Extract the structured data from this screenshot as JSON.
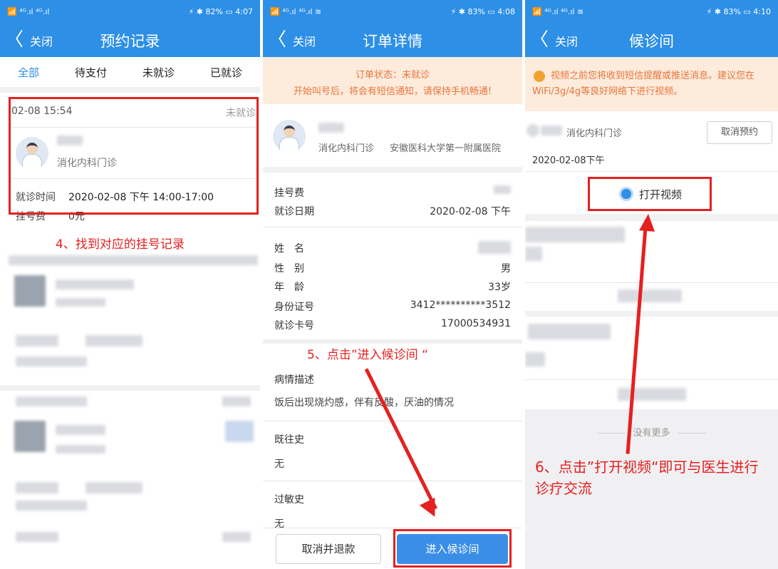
{
  "colors": {
    "brand": "#2d8fe6",
    "annotation": "#e52020",
    "notice_bg": "#fdebdc",
    "notice_text": "#e8763a",
    "primary_button": "#3a8ee6"
  },
  "panel1": {
    "status": {
      "left": "📶 ⁴ᴳ.ıl ⁴ᴳ.ıl",
      "right": "⚡ ✱ 82% ▭ 4:07"
    },
    "nav": {
      "back": "〈",
      "close": "关闭",
      "title": "预约记录"
    },
    "tabs": [
      "全部",
      "待支付",
      "未就诊",
      "已就诊"
    ],
    "record": {
      "datetime": "02-08 15:54",
      "status": "未就诊",
      "dept": "消化内科门诊",
      "visit_time_label": "就诊时间",
      "visit_time_value": "2020-02-08 下午 14:00-17:00",
      "fee_label": "挂号费",
      "fee_value": "0元"
    },
    "annotation": "4、找到对应的挂号记录"
  },
  "panel2": {
    "status": {
      "left": "📶 ⁴ᴳ.ıl ⁴ᴳ.ıl ≋",
      "right": "⚡ ✱ 83% ▭ 4:08"
    },
    "nav": {
      "back": "〈",
      "close": "关闭",
      "title": "订单详情"
    },
    "notice": {
      "line1": "订单状态：未就诊",
      "line2": "开始叫号后，将会有短信通知，请保持手机畅通!"
    },
    "doctor": {
      "dept": "消化内科门诊",
      "hospital": "安徽医科大学第一附属医院"
    },
    "fee_label": "挂号费",
    "visit_date_label": "就诊日期",
    "visit_date_value": "2020-02-08 下午",
    "fields": [
      {
        "label": "姓　名",
        "value": ""
      },
      {
        "label": "性　别",
        "value": "男"
      },
      {
        "label": "年　龄",
        "value": "33岁"
      },
      {
        "label": "身份证号",
        "value": "3412**********3512"
      },
      {
        "label": "就诊卡号",
        "value": "17000534931"
      }
    ],
    "annotation": "5、点击”进入候诊间 “",
    "desc_label": "病情描述",
    "desc_value": "饭后出现烧灼感，伴有反酸，厌油的情况",
    "history_label": "既往史",
    "history_value": "无",
    "allergy_label": "过敏史",
    "allergy_value": "无",
    "btn_cancel": "取消并退款",
    "btn_enter": "进入候诊间"
  },
  "panel3": {
    "status": {
      "left": "📶 ⁴ᴳ.ıl ⁴ᴳ.ıl ≋",
      "right": "⚡ ✱ 83% ▭ 4:10"
    },
    "nav": {
      "back": "〈",
      "close": "关闭",
      "title": "候诊间"
    },
    "notice": "视频之前您将收到短信提醒或推送消息。建议您在WiFi/3g/4g等良好网络下进行视频。",
    "dept": "消化内科门诊",
    "cancel_btn": "取消预约",
    "date": "2020-02-08下午",
    "video_btn": "打开视频",
    "no_more": "没有更多",
    "annotation": "6、点击”打开视频“即可与医生进行诊疗交流"
  }
}
